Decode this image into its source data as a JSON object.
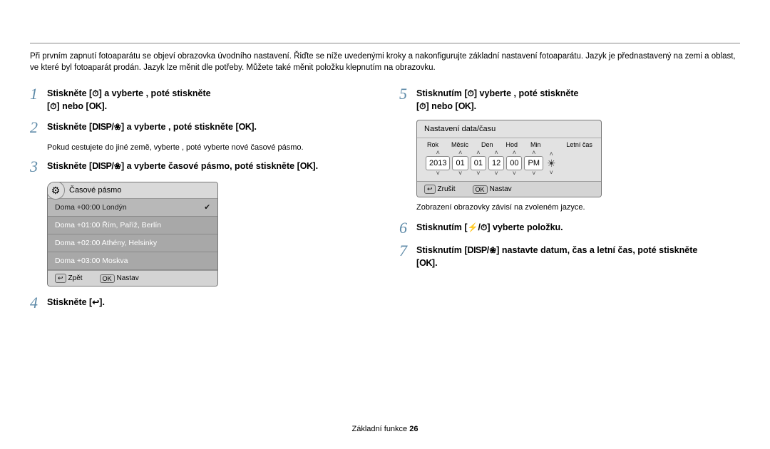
{
  "intro": "Při prvním zapnutí fotoaparátu se objeví obrazovka úvodního nastavení. Řiďte se níže uvedenými kroky a nakonfigurujte základní nastavení fotoaparátu. Jazyk je přednastavený na zemi a oblast, ve které byl fotoaparát prodán. Jazyk lze měnit dle potřeby. Můžete také měnit položku klepnutím na obrazovku.",
  "steps": {
    "s1a": "Stiskněte [",
    "s1b": "] a vyberte",
    "s1c": ", poté stiskněte",
    "s1d": "[",
    "s1e": "] nebo [",
    "s1f": "].",
    "s2a": "Stiskněte [",
    "s2b": "] a vyberte",
    "s2c": ", poté stiskněte [",
    "s2d": "].",
    "s2sub": "Pokud cestujete do jiné země, vyberte             , poté vyberte nové časové pásmo.",
    "s3a": "Stiskněte [",
    "s3b": "] a vyberte časové pásmo, poté stiskněte [",
    "s3c": "].",
    "s4a": "Stiskněte [",
    "s4b": "].",
    "s5a": "Stisknutím [",
    "s5b": "] vyberte",
    "s5c": ", poté stiskněte",
    "s5d": "[",
    "s5e": "] nebo [",
    "s5f": "].",
    "s6a": "Stisknutím [",
    "s6b": "] vyberte položku.",
    "s7a": "Stisknutím [",
    "s7b": "] nastavte datum, čas a letní čas, poté stiskněte",
    "s7c": "[",
    "s7d": "]."
  },
  "icons": {
    "timer": "⏱",
    "bolt": "⚡",
    "flower": "❀",
    "ok": "OK",
    "disp": "DISP",
    "back": "↩",
    "menu": "MENU",
    "gear": "⚙",
    "sun": "☀",
    "check": "✔"
  },
  "tz_panel": {
    "title": "Časové pásmo",
    "rows": [
      "Doma +00:00  Londýn",
      "Doma +01:00  Řím, Paříž, Berlín",
      "Doma +02:00  Athény, Helsinky",
      "Doma +03:00  Moskva"
    ],
    "back": "Zpět",
    "set": "Nastav"
  },
  "dt_panel": {
    "title": "Nastavení data/času",
    "labels": [
      "Rok",
      "Měsíc",
      "Den",
      "Hod",
      "Min",
      "",
      "Letní čas"
    ],
    "vals": [
      "2013",
      "01",
      "01",
      "12",
      "00",
      "PM"
    ],
    "cancel": "Zrušit",
    "set": "Nastav"
  },
  "note": "Zobrazení obrazovky závisí na zvoleném jazyce.",
  "footer_label": "Základní funkce",
  "footer_page": "26"
}
